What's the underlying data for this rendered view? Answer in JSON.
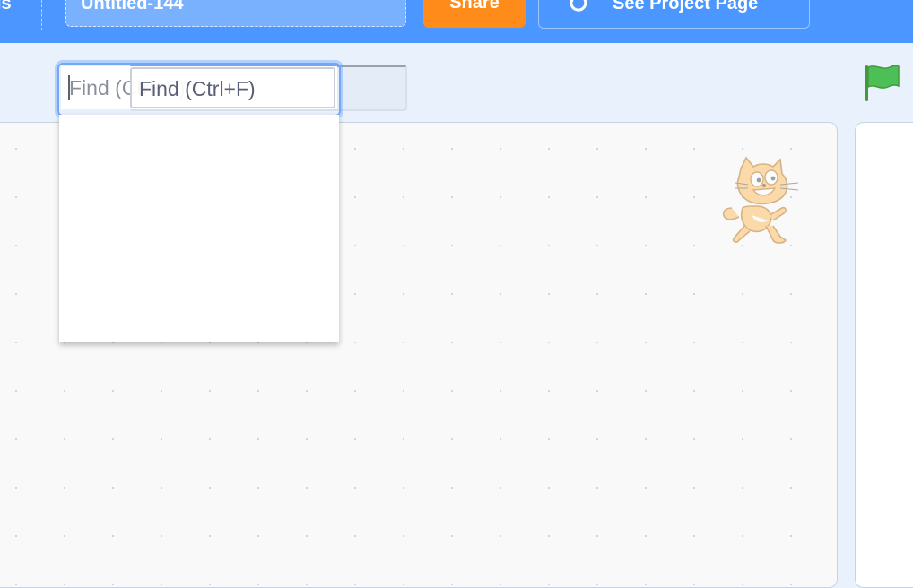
{
  "menubar": {
    "partial_menu_label": "ls",
    "project_title": "Untitled-144",
    "share_label": "Share",
    "see_project_label": "See Project Page"
  },
  "find": {
    "placeholder": "Find (Ctrl+F)",
    "ghost_text": "Find (Ctrl+F)"
  },
  "icons": {
    "see_project": "remix-arrow-icon",
    "green_flag": "green-flag-icon",
    "sprite": "scratch-cat-sprite"
  },
  "colors": {
    "menubar": "#4c97ff",
    "share": "#ff8c1a",
    "flag": "#4cbf56",
    "focus": "#73a7f6"
  }
}
